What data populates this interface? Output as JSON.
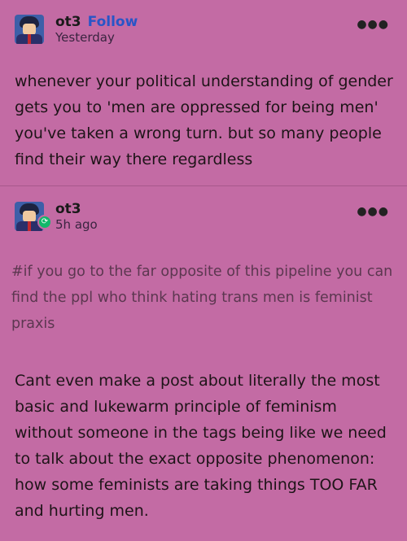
{
  "post1": {
    "username": "ot3",
    "follow_label": "Follow",
    "timestamp": "Yesterday",
    "more_icon": "more-dots-icon",
    "body": "whenever your political understanding of gender gets you to 'men are oppressed for being men' you've taken a wrong turn. but so many people find their way there regardless"
  },
  "post2": {
    "username": "ot3",
    "timestamp": "5h ago",
    "more_icon": "more-dots-icon",
    "reblog_icon": "reblog-icon",
    "tags": "#if you go to the far opposite of this pipeline you can find the ppl who think hating trans men is feminist praxis",
    "body": "Cant even make a post about literally the most basic and lukewarm principle of feminism without someone in the tags being like we need to talk about the exact opposite phenomenon: how some feminists are taking things TOO FAR and hurting men."
  },
  "colors": {
    "background": "#c36ba4",
    "follow": "#2855c7",
    "reblog_badge": "#11b86a"
  }
}
